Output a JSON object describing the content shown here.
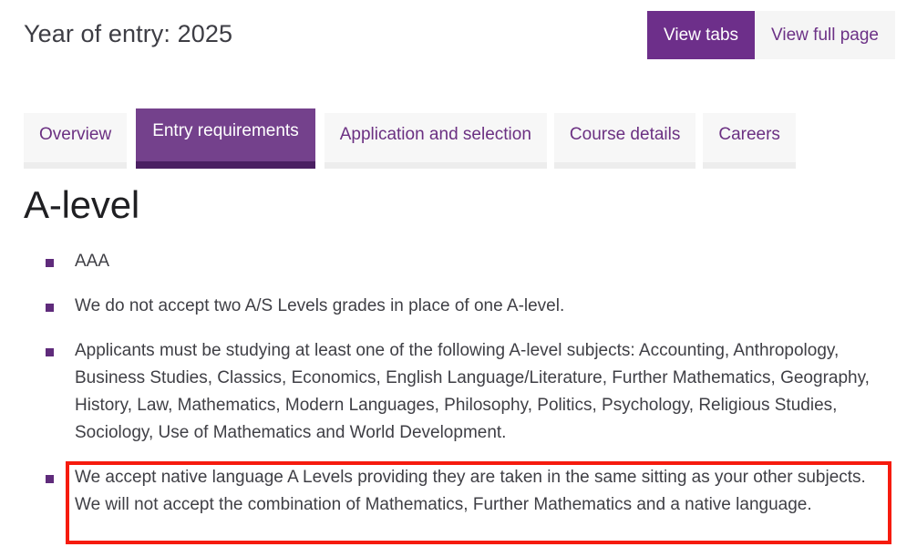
{
  "header": {
    "title": "Year of entry: 2025",
    "view_toggle": {
      "tabs_label": "View tabs",
      "full_page_label": "View full page",
      "active": "View tabs"
    }
  },
  "tabs": [
    {
      "label": "Overview",
      "active": false
    },
    {
      "label": "Entry requirements",
      "active": true
    },
    {
      "label": "Application and selection",
      "active": false
    },
    {
      "label": "Course details",
      "active": false
    },
    {
      "label": "Careers",
      "active": false
    }
  ],
  "main": {
    "heading": "A-level",
    "requirements": [
      "AAA",
      "We do not accept two A/S Levels grades in place of one A-level.",
      "Applicants must be studying at least one of the following A-level subjects: Accounting, Anthropology, Business Studies, Classics, Economics, English Language/Literature, Further Mathematics, Geography, History, Law, Mathematics, Modern Languages, Philosophy, Politics, Psychology, Religious Studies, Sociology, Use of Mathematics and World Development.",
      "We accept native language A Levels providing they are taken in the same sitting as your other subjects. We will not accept the combination of Mathematics, Further Mathematics and a native language."
    ]
  },
  "annotation": {
    "type": "highlight-rectangle",
    "target": "native-language-a-levels-bullet",
    "color": "#f61b0e"
  },
  "colors": {
    "brand_purple": "#6d2f8a",
    "active_tab_purple": "#74418c",
    "active_tab_underline": "#4a1f62",
    "bullet_purple": "#5f2b7b",
    "tab_inactive_bg": "#f7f7f7",
    "tab_inactive_text": "#6b3082",
    "annotation_red": "#f61b0e",
    "body_text": "#3f3f45"
  }
}
